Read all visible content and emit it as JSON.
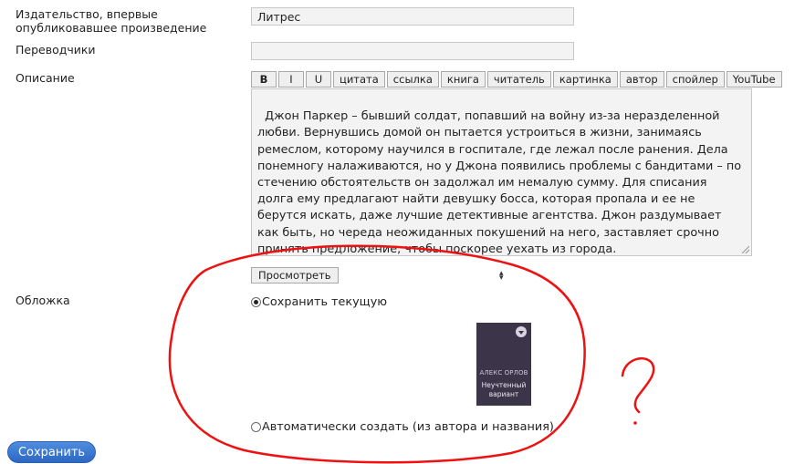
{
  "form": {
    "publisher_label_line1": "Издательство, впервые",
    "publisher_label_line2": "опубликовавшее произведение",
    "publisher_value": "Литрес",
    "translators_label": "Переводчики",
    "translators_value": "",
    "description_label": "Описание",
    "toolbar": [
      "B",
      "I",
      "U",
      "цитата",
      "ссылка",
      "книга",
      "читатель",
      "картинка",
      "автор",
      "спойлер",
      "YouTube"
    ],
    "description_text": "Джон Паркер – бывший солдат, попавший на войну из-за неразделенной любви. Вернувшись домой он пытается устроиться в жизни, занимаясь ремеслом, которому научился в госпитале, где лежал после ранения. Дела понемногу налаживаются, но у Джона появились проблемы с бандитами – по стечению обстоятельств он задолжал им немалую сумму. Для списания долга ему предлагают найти девушку босса, которая пропала и ее не берутся искать, даже лучшие детективные агентства. Джон раздумывает как быть, но череда неожиданных покушений на него, заставляет срочно принять предложение, чтобы поскорее уехать из города.",
    "preview_button": "Просмотреть",
    "cover_label": "Обложка",
    "cover_keep_option": "Сохранить текущую",
    "cover_auto_option": "Автоматически создать (из автора и названия)",
    "cover_author": "АЛЕКС ОРЛОВ",
    "cover_title": "Неучтенный вариант",
    "save_button": "Сохранить"
  },
  "annotation": {
    "color": "#ee1111",
    "mark": "?"
  }
}
